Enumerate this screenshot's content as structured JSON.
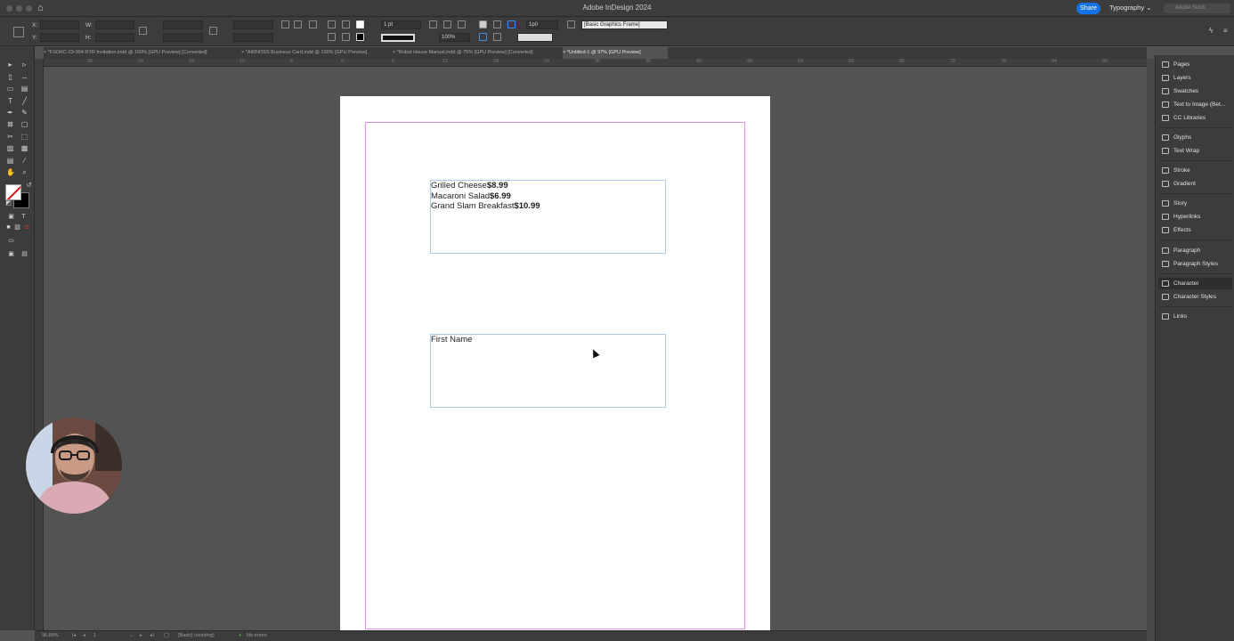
{
  "titlebar": {
    "title": "Adobe InDesign 2024",
    "share_label": "Share",
    "workspace": "Typography",
    "stock_search_placeholder": "Adobe Stock"
  },
  "control_panel": {
    "x_label": "X:",
    "y_label": "Y:",
    "w_label": "W:",
    "h_label": "H:",
    "stroke_weight": "1 pt",
    "opacity": "100%",
    "dimension": "1p0",
    "object_style": "[Basic Graphics Frame]"
  },
  "tabs": [
    {
      "label": "*FSOKC-23-004 RYR Invitation.indd @ 150% [GPU Preview] [Converted]"
    },
    {
      "label": "*AIRNOSS Business Card.indd @ 100% [GPU Preview]"
    },
    {
      "label": "*Robot House Manual.indd @ 75% [GPU Preview] [Converted]"
    },
    {
      "label": "*Untitled-1 @ 97% [GPU Preview]"
    }
  ],
  "ruler_top_ticks": [
    "30",
    "24",
    "18",
    "12",
    "6",
    "0",
    "6",
    "12",
    "18",
    "24",
    "30",
    "36",
    "42",
    "48",
    "54",
    "60",
    "66",
    "72",
    "78",
    "84",
    "90"
  ],
  "document": {
    "menu_lines": [
      {
        "name": "Grilled Cheese",
        "price": "$8.99"
      },
      {
        "name": "Macaroni Salad",
        "price": "$6.99"
      },
      {
        "name": "Grand Slam Breakfast",
        "price": "$10.99"
      }
    ],
    "placeholder_text": "First Name"
  },
  "panels": [
    {
      "label": "Pages",
      "icon": "pages-icon"
    },
    {
      "label": "Layers",
      "icon": "layers-icon"
    },
    {
      "label": "Swatches",
      "icon": "swatches-icon"
    },
    {
      "label": "Text to Image (Bet...",
      "icon": "text-to-image-icon"
    },
    {
      "label": "CC Libraries",
      "icon": "cc-libraries-icon"
    },
    {
      "label": "Glyphs",
      "icon": "glyphs-icon"
    },
    {
      "label": "Text Wrap",
      "icon": "text-wrap-icon"
    },
    {
      "label": "Stroke",
      "icon": "stroke-icon"
    },
    {
      "label": "Gradient",
      "icon": "gradient-icon"
    },
    {
      "label": "Story",
      "icon": "story-icon"
    },
    {
      "label": "Hyperlinks",
      "icon": "hyperlinks-icon"
    },
    {
      "label": "Effects",
      "icon": "effects-icon"
    },
    {
      "label": "Paragraph",
      "icon": "paragraph-icon"
    },
    {
      "label": "Paragraph Styles",
      "icon": "paragraph-styles-icon"
    },
    {
      "label": "Character",
      "icon": "character-icon"
    },
    {
      "label": "Character Styles",
      "icon": "character-styles-icon"
    },
    {
      "label": "Links",
      "icon": "links-icon"
    }
  ],
  "status": {
    "zoom": "96.88%",
    "page": "1",
    "profile": "[Basic] (working)",
    "errors": "No errors"
  },
  "colors": {
    "accent": "#1473e6",
    "margin_guide": "#e38ee5",
    "frame_edge": "#a9cbe8",
    "chrome": "#3c3c3c",
    "pasteboard": "#535353"
  }
}
